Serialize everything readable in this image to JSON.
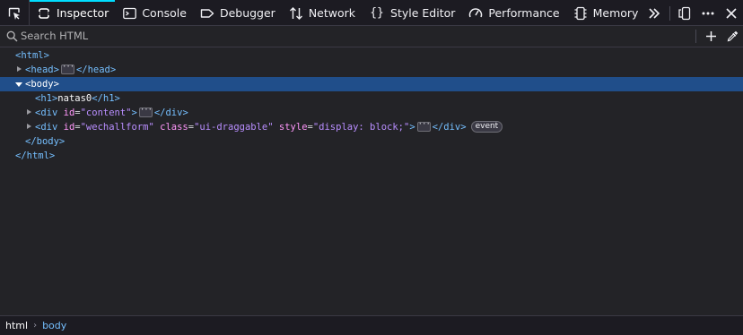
{
  "toolbar": {
    "picker_icon": "element-picker-icon",
    "tabs": [
      {
        "label": "Inspector",
        "icon": "inspector-icon",
        "selected": true
      },
      {
        "label": "Console",
        "icon": "console-icon",
        "selected": false
      },
      {
        "label": "Debugger",
        "icon": "debugger-icon",
        "selected": false
      },
      {
        "label": "Network",
        "icon": "network-icon",
        "selected": false
      },
      {
        "label": "Style Editor",
        "icon": "style-editor-icon",
        "selected": false
      },
      {
        "label": "Performance",
        "icon": "performance-icon",
        "selected": false
      },
      {
        "label": "Memory",
        "icon": "memory-icon",
        "selected": false
      }
    ],
    "accent_color": "#00ddff"
  },
  "search": {
    "placeholder": "Search HTML",
    "value": ""
  },
  "markup": {
    "html_open": "<html>",
    "head_open": "<head>",
    "head_close": "</head>",
    "body_open": "<body>",
    "h1_open": "<h1>",
    "h1_text": "natas0",
    "h1_close": "</h1>",
    "div1_open": "<div",
    "div1_attr_name": "id",
    "div1_attr_value": "\"content\"",
    "div1_gt": ">",
    "div1_close": "</div>",
    "div2_open": "<div",
    "div2_attrs": [
      {
        "name": "id",
        "value": "\"wechallform\""
      },
      {
        "name": "class",
        "value": "\"ui-draggable\""
      },
      {
        "name": "style",
        "value": "\"display: block;\""
      }
    ],
    "div2_gt": ">",
    "div2_close": "</div>",
    "event_badge": "event",
    "body_close": "</body>",
    "html_close": "</html>",
    "selected_row_color": "#204e8a"
  },
  "breadcrumbs": {
    "items": [
      "html",
      "body"
    ]
  }
}
